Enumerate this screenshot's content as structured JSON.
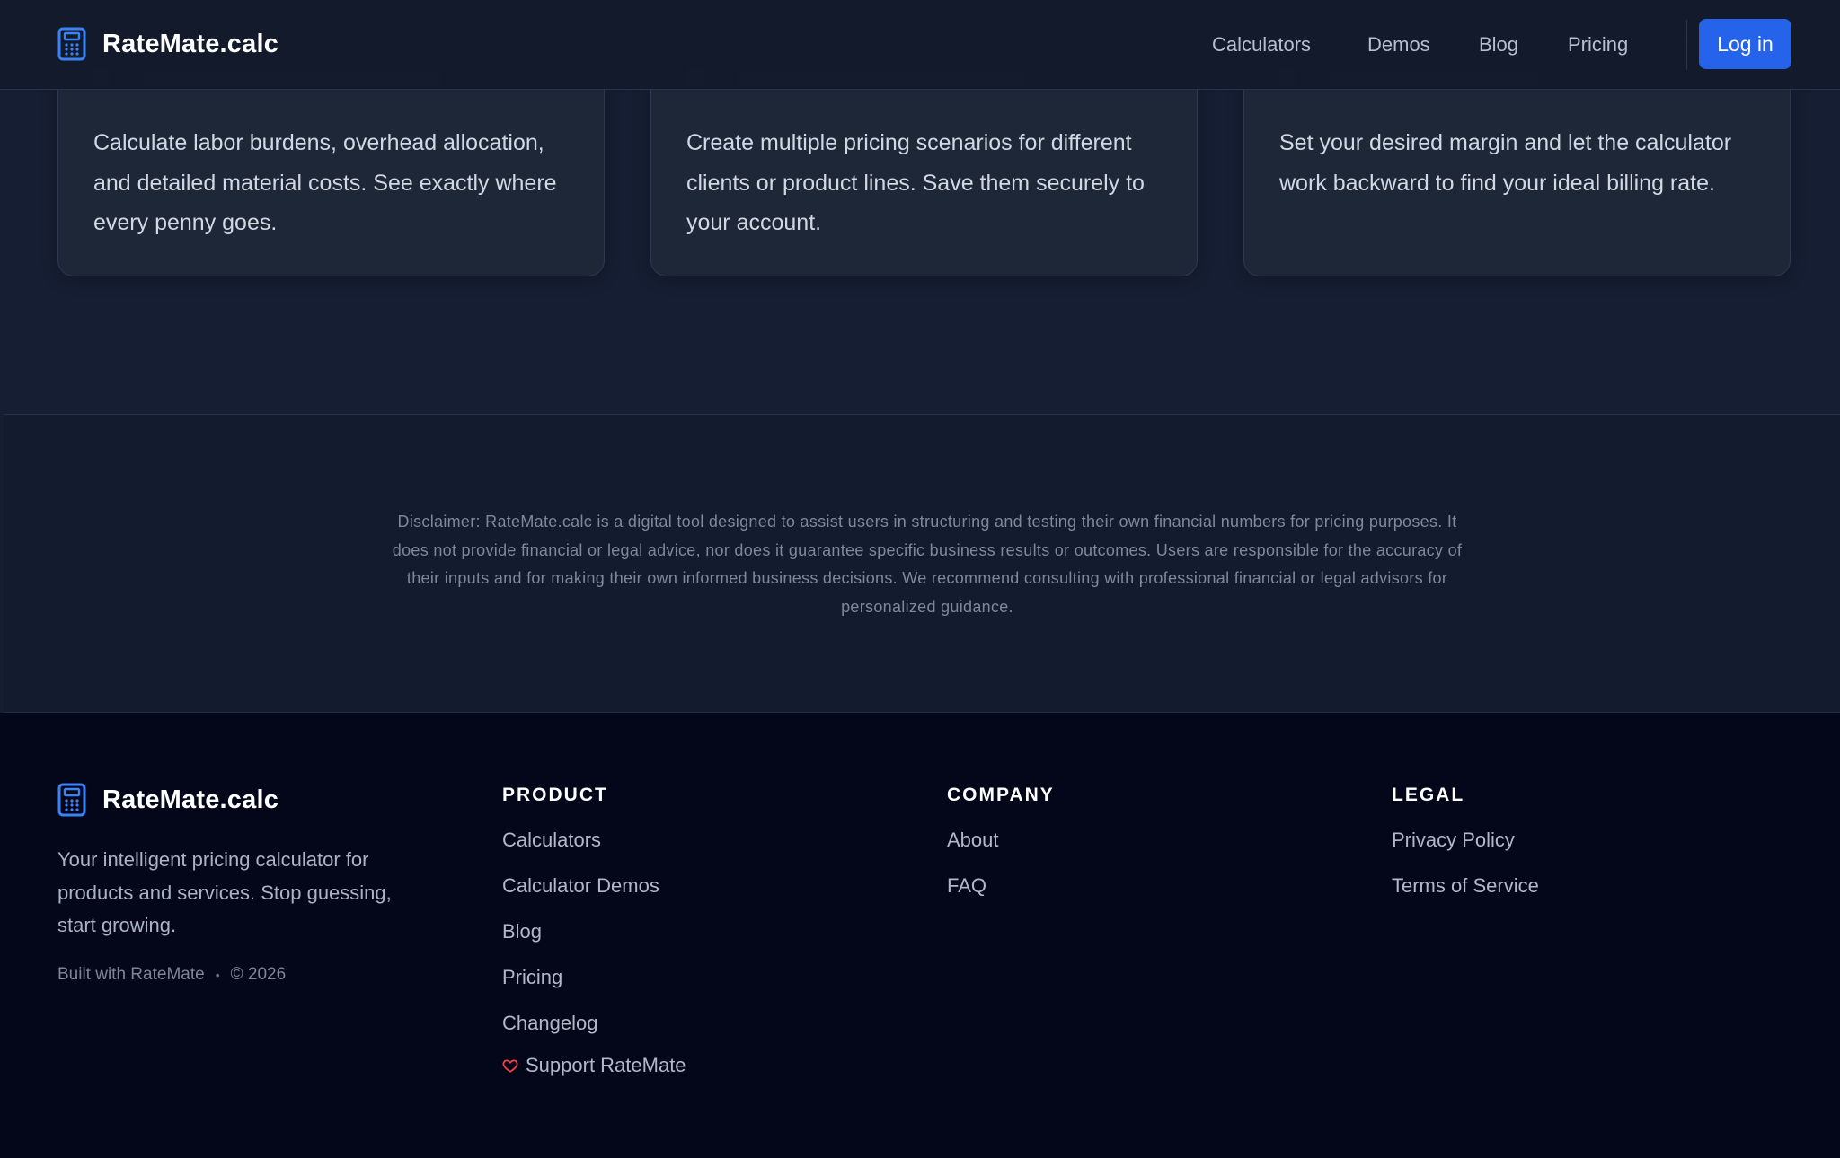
{
  "header": {
    "brand": "RateMate.calc",
    "nav": [
      "Calculators",
      "Demos",
      "Blog",
      "Pricing"
    ],
    "login_label": "Log in"
  },
  "features": {
    "cards": [
      {
        "text": "Calculate labor burdens, overhead allocation, and detailed material costs. See exactly where every penny goes."
      },
      {
        "text": "Create multiple pricing scenarios for different clients or product lines. Save them securely to your account."
      },
      {
        "text": "Set your desired margin and let the calculator work backward to find your ideal billing rate."
      }
    ]
  },
  "disclaimer": "Disclaimer: RateMate.calc is a digital tool designed to assist users in structuring and testing their own financial numbers for pricing purposes. It does not provide financial or legal advice, nor does it guarantee specific business results or outcomes. Users are responsible for the accuracy of their inputs and for making their own informed business decisions. We recommend consulting with professional financial or legal advisors for personalized guidance.",
  "footer": {
    "brand": "RateMate.calc",
    "tagline": "Your intelligent pricing calculator for products and services. Stop guessing, start growing.",
    "built_with": "Built with RateMate",
    "copyright": "© 2026",
    "columns": [
      {
        "title": "PRODUCT",
        "links": [
          "Calculators",
          "Calculator Demos",
          "Blog",
          "Pricing",
          "Changelog"
        ],
        "extra": "Support RateMate"
      },
      {
        "title": "COMPANY",
        "links": [
          "About",
          "FAQ"
        ]
      },
      {
        "title": "LEGAL",
        "links": [
          "Privacy Policy",
          "Terms of Service"
        ]
      }
    ]
  },
  "colors": {
    "accent": "#2563eb",
    "icon_blue": "#3b82f6",
    "heart": "#ef4444"
  },
  "icons": {
    "brand": "calculator-icon",
    "support": "heart-icon"
  }
}
